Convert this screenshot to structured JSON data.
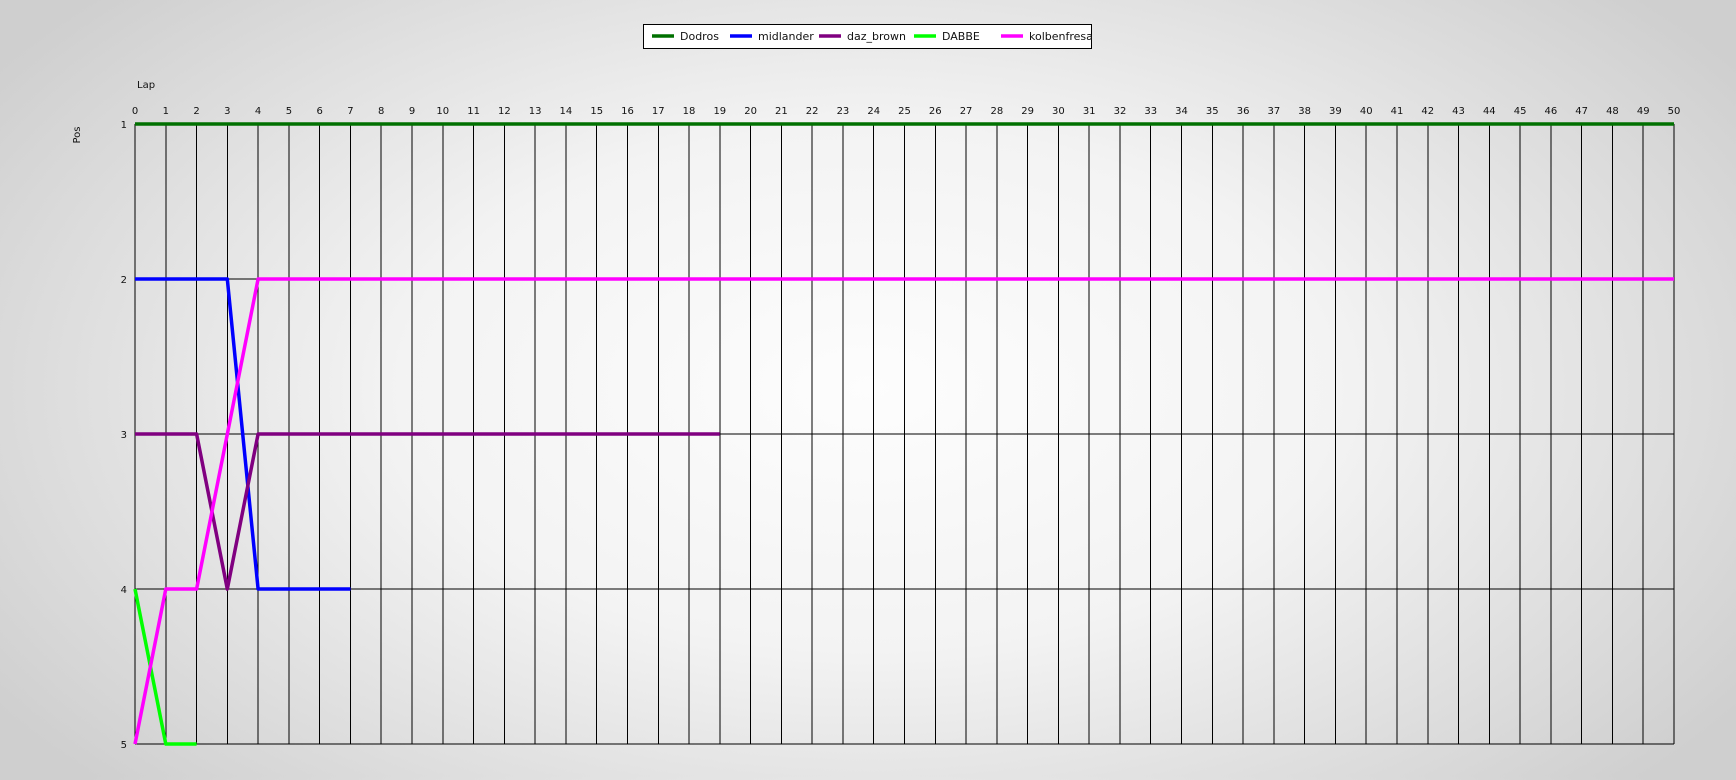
{
  "chart_data": {
    "type": "line",
    "title": "",
    "xlabel": "Lap",
    "ylabel": "Pos",
    "x_ticks": [
      0,
      1,
      2,
      3,
      4,
      5,
      6,
      7,
      8,
      9,
      10,
      11,
      12,
      13,
      14,
      15,
      16,
      17,
      18,
      19,
      20,
      21,
      22,
      23,
      24,
      25,
      26,
      27,
      28,
      29,
      30,
      31,
      32,
      33,
      34,
      35,
      36,
      37,
      38,
      39,
      40,
      41,
      42,
      43,
      44,
      45,
      46,
      47,
      48,
      49,
      50
    ],
    "y_ticks": [
      1,
      2,
      3,
      4,
      5
    ],
    "xlim": [
      0,
      50
    ],
    "ylim": [
      1,
      5
    ],
    "y_inverted": true,
    "grid": true,
    "legend_position": "top-center",
    "series": [
      {
        "name": "Dodros",
        "color": "#007000",
        "x": [
          0,
          50
        ],
        "y": [
          1,
          1
        ]
      },
      {
        "name": "midlander",
        "color": "#0000ff",
        "x": [
          0,
          3,
          4,
          7
        ],
        "y": [
          2,
          2,
          4,
          4
        ]
      },
      {
        "name": "daz_brown",
        "color": "#800080",
        "x": [
          0,
          2,
          3,
          4,
          19
        ],
        "y": [
          3,
          3,
          4,
          3,
          3
        ]
      },
      {
        "name": "DABBE",
        "color": "#00ff00",
        "x": [
          0,
          1,
          2
        ],
        "y": [
          4,
          5,
          5
        ]
      },
      {
        "name": "kolbenfresa",
        "color": "#ff00ff",
        "x": [
          0,
          1,
          2,
          4,
          50
        ],
        "y": [
          5,
          4,
          4,
          2,
          2
        ]
      }
    ]
  }
}
